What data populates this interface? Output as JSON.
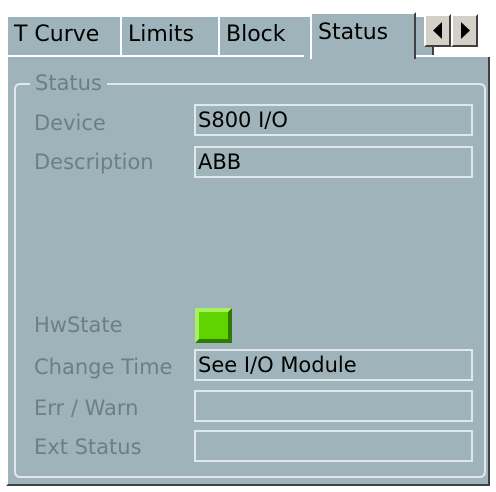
{
  "tabs": [
    {
      "label": "T Curve",
      "active": false
    },
    {
      "label": "Limits",
      "active": false
    },
    {
      "label": "Block",
      "active": false
    },
    {
      "label": "Status",
      "active": true
    }
  ],
  "tab_scroll": {
    "left_icon": "arrow-left-icon",
    "right_icon": "arrow-right-icon"
  },
  "group": {
    "title": "Status"
  },
  "fields": {
    "device": {
      "label": "Device",
      "value": "S800 I/O"
    },
    "description": {
      "label": "Description",
      "value": "ABB"
    },
    "hwstate": {
      "label": "HwState",
      "indicator_color": "#5fd400",
      "icon": "status-indicator-icon"
    },
    "change_time": {
      "label": "Change Time",
      "value": "See I/O Module"
    },
    "err_warn": {
      "label": "Err / Warn",
      "value": ""
    },
    "ext_status": {
      "label": "Ext Status",
      "value": ""
    }
  },
  "colors": {
    "panel_bg": "#9eb4ba",
    "label_text": "#6d7f84",
    "ok_green": "#5fd400"
  }
}
